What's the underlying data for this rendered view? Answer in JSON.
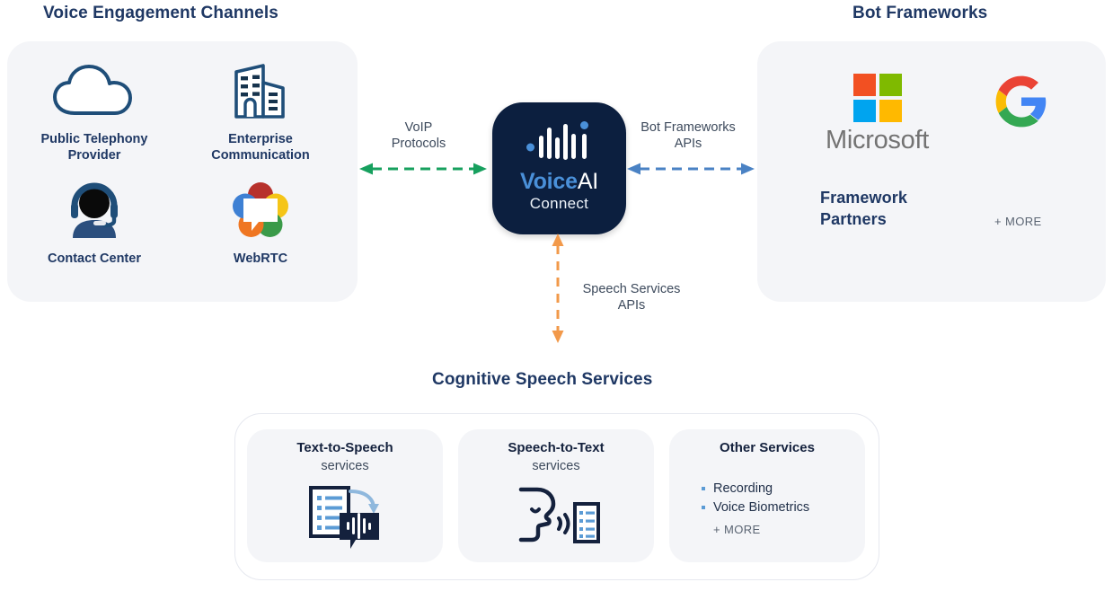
{
  "sections": {
    "left_title": "Voice Engagement Channels",
    "right_title": "Bot Frameworks",
    "bottom_title": "Cognitive Speech Services"
  },
  "channels": [
    {
      "label": "Public Telephony\nProvider",
      "icon": "cloud-icon"
    },
    {
      "label": "Enterprise\nCommunication",
      "icon": "office-building-icon"
    },
    {
      "label": "Contact Center",
      "icon": "headset-agent-icon"
    },
    {
      "label": "WebRTC",
      "icon": "webrtc-logo-icon"
    }
  ],
  "hub": {
    "logo_voice": "Voice",
    "logo_ai": "AI",
    "logo_connect": "Connect",
    "background": "#0c1f3f",
    "accent": "#4a90d9"
  },
  "connectors": [
    {
      "id": "voip",
      "label": "VoIP\nProtocols",
      "color": "#17a05e",
      "direction": "bidirectional",
      "orientation": "horizontal"
    },
    {
      "id": "bot-frameworks-apis",
      "label": "Bot Frameworks\nAPIs",
      "color": "#4a82c4",
      "direction": "bidirectional",
      "orientation": "horizontal"
    },
    {
      "id": "speech-services-apis",
      "label": "Speech Services\nAPIs",
      "color": "#f2994a",
      "direction": "bidirectional",
      "orientation": "vertical"
    }
  ],
  "frameworks": {
    "microsoft": {
      "wordmark": "Microsoft",
      "icon": "microsoft-logo-icon",
      "colors": [
        "#f25022",
        "#7fba00",
        "#00a4ef",
        "#ffb900"
      ]
    },
    "google": {
      "icon": "google-g-logo-icon",
      "colors": [
        "#ea4335",
        "#fbbc05",
        "#34a853",
        "#4285f4"
      ]
    },
    "partners_label": "Framework\nPartners",
    "more_label": "+ MORE"
  },
  "speech_services": [
    {
      "title": "Text-to-Speech",
      "subtitle": "services",
      "icon": "text-to-speech-icon",
      "bullets": [],
      "more_label": ""
    },
    {
      "title": "Speech-to-Text",
      "subtitle": "services",
      "icon": "speech-to-text-icon",
      "bullets": [],
      "more_label": ""
    },
    {
      "title": "Other Services",
      "subtitle": "",
      "icon": "",
      "bullets": [
        "Recording",
        "Voice Biometrics"
      ],
      "more_label": "+ MORE"
    }
  ],
  "colors": {
    "title_navy": "#1f3864",
    "panel_bg": "#f4f5f8",
    "icon_navy": "#1f4e79",
    "body_text": "#3d4a5c"
  }
}
